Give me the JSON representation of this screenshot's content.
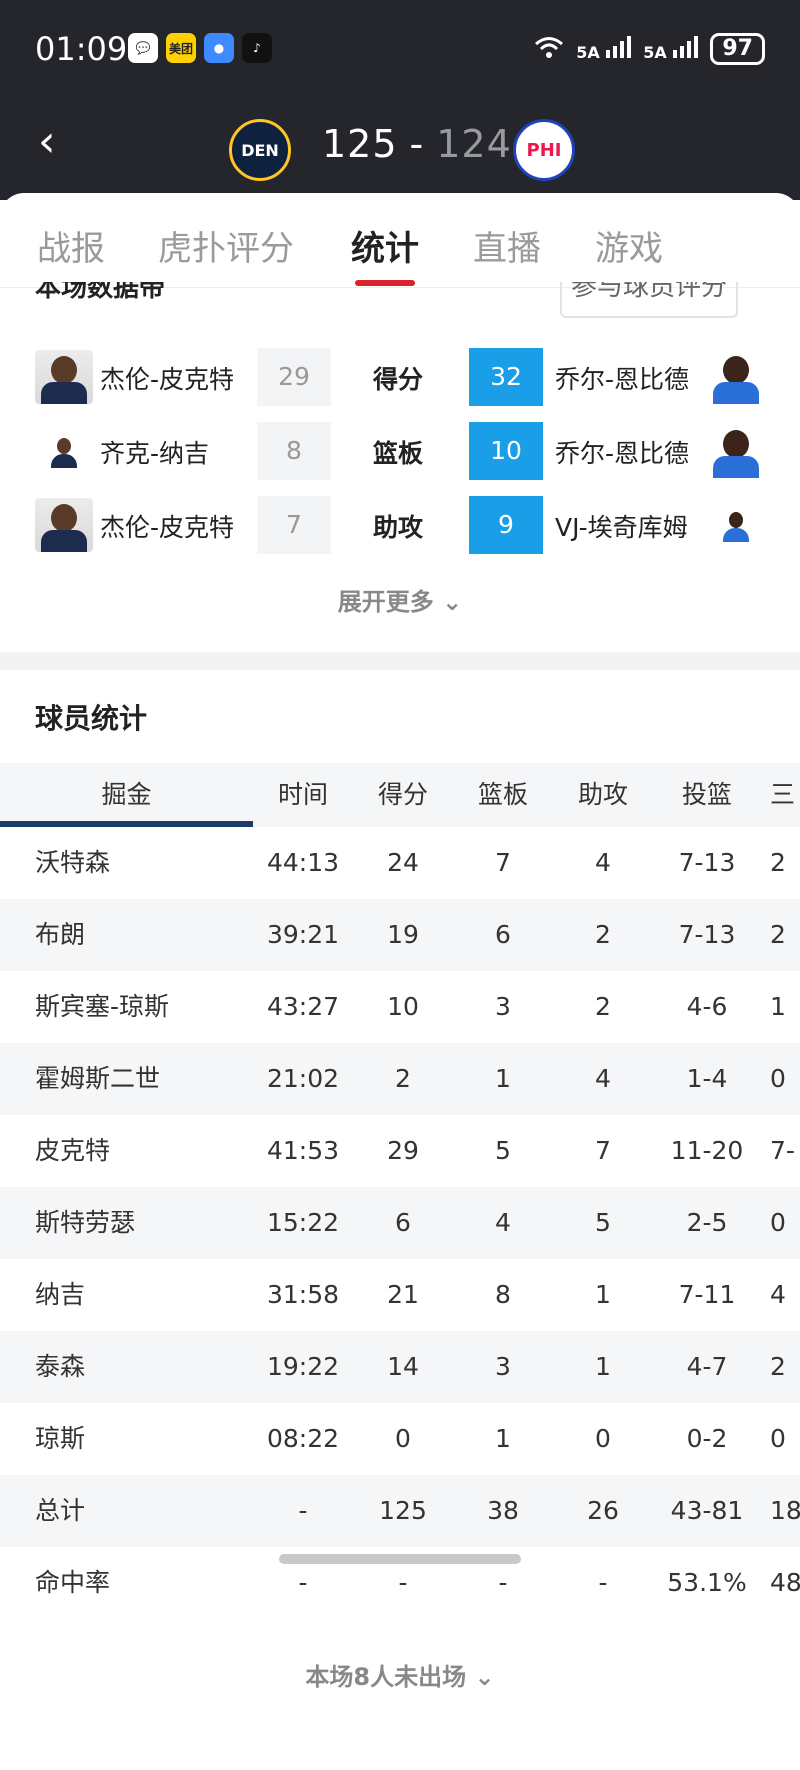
{
  "status_bar": {
    "time": "01:09",
    "app_icons": [
      {
        "name": "chat-bubble-icon",
        "bg": "#ffffff",
        "label": "💬"
      },
      {
        "name": "meituan-icon",
        "bg": "#ffd100",
        "label": "美团"
      },
      {
        "name": "message-icon",
        "bg": "#3d8bff",
        "label": "●"
      },
      {
        "name": "tiktok-icon",
        "bg": "#111111",
        "label": "♪"
      }
    ],
    "signal1": "5A",
    "signal2": "5A",
    "battery": "97"
  },
  "header": {
    "home_team_logo": "DEN",
    "away_team_logo": "PHI",
    "home_score": "125",
    "separator": "-",
    "away_score": "124"
  },
  "tabs": [
    "战报",
    "虎扑评分",
    "统计",
    "直播",
    "游戏"
  ],
  "active_tab": "统计",
  "leaders": {
    "section_title": "本场数据帝",
    "rate_button": "参与球员评分",
    "rows": [
      {
        "home_player": "杰伦-皮克特",
        "home_value": "29",
        "category": "得分",
        "away_value": "32",
        "away_player": "乔尔-恩比德"
      },
      {
        "home_player": "齐克-纳吉",
        "home_value": "8",
        "category": "篮板",
        "away_value": "10",
        "away_player": "乔尔-恩比德"
      },
      {
        "home_player": "杰伦-皮克特",
        "home_value": "7",
        "category": "助攻",
        "away_value": "9",
        "away_player": "VJ-埃奇库姆"
      }
    ],
    "expand_more": "展开更多 ⌄"
  },
  "player_stats": {
    "section_title": "球员统计",
    "team_tab": "掘金",
    "columns": [
      "时间",
      "得分",
      "篮板",
      "助攻",
      "投篮",
      "三"
    ],
    "rows": [
      [
        "沃特森",
        "44:13",
        "24",
        "7",
        "4",
        "7-13",
        "2"
      ],
      [
        "布朗",
        "39:21",
        "19",
        "6",
        "2",
        "7-13",
        "2"
      ],
      [
        "斯宾塞-琼斯",
        "43:27",
        "10",
        "3",
        "2",
        "4-6",
        "1"
      ],
      [
        "霍姆斯二世",
        "21:02",
        "2",
        "1",
        "4",
        "1-4",
        "0"
      ],
      [
        "皮克特",
        "41:53",
        "29",
        "5",
        "7",
        "11-20",
        "7-"
      ],
      [
        "斯特劳瑟",
        "15:22",
        "6",
        "4",
        "5",
        "2-5",
        "0"
      ],
      [
        "纳吉",
        "31:58",
        "21",
        "8",
        "1",
        "7-11",
        "4"
      ],
      [
        "泰森",
        "19:22",
        "14",
        "3",
        "1",
        "4-7",
        "2"
      ],
      [
        "琼斯",
        "08:22",
        "0",
        "1",
        "0",
        "0-2",
        "0"
      ],
      [
        "总计",
        "-",
        "125",
        "38",
        "26",
        "43-81",
        "18"
      ],
      [
        "命中率",
        "-",
        "-",
        "-",
        "-",
        "53.1%",
        "48"
      ]
    ],
    "bench_note": "本场8人未出场 ⌄"
  }
}
